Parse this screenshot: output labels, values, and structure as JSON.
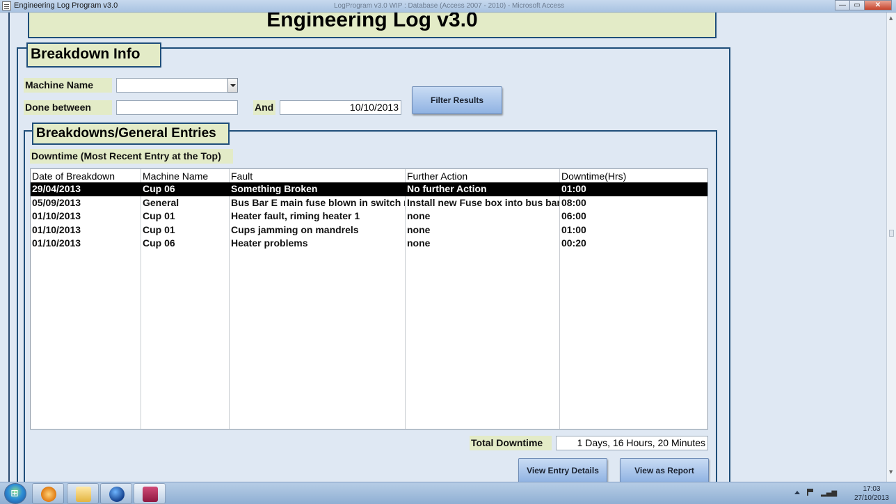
{
  "window": {
    "title": "Engineering Log Program v3.0",
    "center_title": "LogProgram v3.0 WIP : Database (Access 2007 - 2010) - Microsoft Access",
    "buttons": {
      "minimize": "—",
      "maximize": "▭",
      "close": "✕"
    }
  },
  "form": {
    "banner_title": "Engineering Log v3.0",
    "breakdown_section": "Breakdown Info",
    "machine_name_label": "Machine Name",
    "machine_name_value": "",
    "done_between_label": "Done between",
    "date_from_value": "",
    "and_label": "And",
    "date_to_value": "10/10/2013",
    "filter_button": "Filter Results",
    "entries_section": "Breakdowns/General Entries",
    "downtime_caption": "Downtime (Most Recent Entry at the Top)",
    "total_downtime_label": "Total Downtime",
    "total_downtime_value": "1 Days, 16 Hours, 20 Minutes",
    "view_details_button": "View Entry Details",
    "view_report_button": "View as Report"
  },
  "table": {
    "headers": [
      "Date of Breakdown",
      "Machine Name",
      "Fault",
      "Further Action",
      "Downtime(Hrs)"
    ],
    "rows": [
      [
        "29/04/2013",
        "Cup 06",
        "Something Broken",
        "No further Action",
        "01:00"
      ],
      [
        "05/09/2013",
        "General",
        "Bus Bar E main fuse blown in switch room",
        "Install new Fuse box into bus bar fed",
        "08:00"
      ],
      [
        "01/10/2013",
        "Cup 01",
        "Heater fault, riming heater 1",
        "none",
        "06:00"
      ],
      [
        "01/10/2013",
        "Cup 01",
        "Cups jamming on mandrels",
        "none",
        "01:00"
      ],
      [
        "01/10/2013",
        "Cup 06",
        "Heater problems",
        "none",
        "00:20"
      ]
    ]
  },
  "taskbar": {
    "time": "17:03",
    "date": "27/10/2013"
  },
  "colors": {
    "label_bg": "#e3ebc7",
    "frame_border": "#1f4e79",
    "button_bg": "#8fb2e2",
    "selected_row": "#000000"
  }
}
